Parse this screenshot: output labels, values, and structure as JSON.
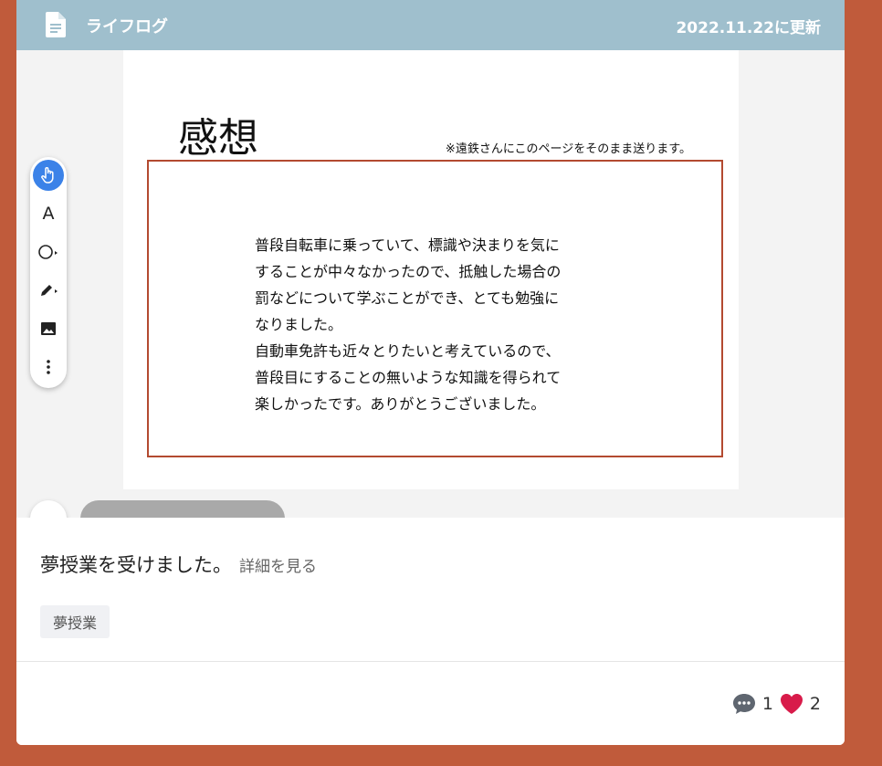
{
  "header": {
    "title": "ライフログ",
    "date": "2022.11.22に更新",
    "icon": "document-icon"
  },
  "page": {
    "heading": "感想",
    "note": "※遠鉄さんにこのページをそのまま送ります。",
    "body": "普段自転車に乗っていて、標識や決まりを気に\nすることが中々なかったので、抵触した場合の\n罰などについて学ぶことができ、とても勉強に\nなりました。\n自動車免許も近々とりたいと考えているので、\n普段目にすることの無いような知識を得られて\n楽しかったです。ありがとうございました。"
  },
  "toolbar": {
    "tools": [
      "hand-icon",
      "text-icon",
      "shape-icon",
      "pen-icon",
      "image-icon",
      "more-icon"
    ],
    "text_tool_label": "A",
    "active": "hand-icon",
    "accent": "#3b82e8"
  },
  "post": {
    "description": "夢授業を受けました。",
    "detail_link": "詳細を見る",
    "tag": "夢授業"
  },
  "stats": {
    "comments": "1",
    "likes": "2"
  },
  "colors": {
    "background": "#c05b3b",
    "header": "#9fbfcd",
    "box_border": "#b34a30",
    "heart": "#d81b4a"
  }
}
